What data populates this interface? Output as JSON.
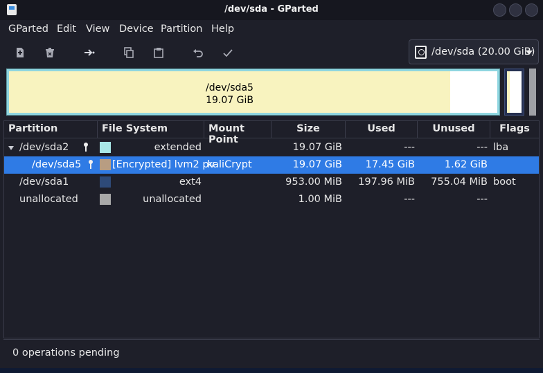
{
  "window": {
    "title": "/dev/sda - GParted"
  },
  "menu": [
    "GParted",
    "Edit",
    "View",
    "Device",
    "Partition",
    "Help"
  ],
  "toolbar": {
    "icons": [
      "new-partition-icon",
      "delete-partition-icon",
      "resize-move-icon",
      "copy-icon",
      "paste-icon",
      "undo-icon",
      "apply-icon"
    ],
    "device": "/dev/sda (20.00 GiB)"
  },
  "graph": {
    "name": "/dev/sda5",
    "size": "19.07 GiB"
  },
  "table": {
    "headers": [
      "Partition",
      "File System",
      "Mount Point",
      "Size",
      "Used",
      "Unused",
      "Flags"
    ],
    "rows": [
      {
        "partition": "/dev/sda2",
        "fs": "extended",
        "mount": "",
        "size": "19.07 GiB",
        "used": "---",
        "unused": "---",
        "flags": "lba",
        "color": "#a8e8e8",
        "locked": true,
        "expanded": true
      },
      {
        "partition": "/dev/sda5",
        "fs": "[Encrypted] lvm2 pv",
        "mount": "kaliCrypt",
        "size": "19.07 GiB",
        "used": "17.45 GiB",
        "unused": "1.62 GiB",
        "flags": "",
        "color": "#b89d82",
        "locked": true,
        "selected": true
      },
      {
        "partition": "/dev/sda1",
        "fs": "ext4",
        "mount": "",
        "size": "953.00 MiB",
        "used": "197.96 MiB",
        "unused": "755.04 MiB",
        "flags": "boot",
        "color": "#2e4a78",
        "locked": false
      },
      {
        "partition": "unallocated",
        "fs": "unallocated",
        "mount": "",
        "size": "1.00 MiB",
        "used": "---",
        "unused": "---",
        "flags": "",
        "color": "#a8a8a8",
        "locked": false
      }
    ]
  },
  "status": {
    "text": "0 operations pending"
  }
}
